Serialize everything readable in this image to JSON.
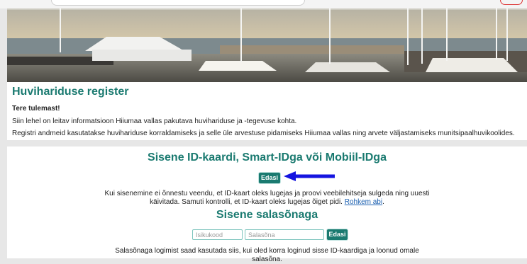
{
  "header": {
    "title": "Huvihariduse register",
    "welcome": "Tere tulemast!",
    "paragraph_1": "Siin lehel on leitav informatsioon Hiiumaa vallas pakutava huvihariduse ja -tegevuse kohta.",
    "paragraph_2": "Registri andmeid kasutatakse huvihariduse korraldamiseks ja selle üle arvestuse pidamiseks Hiiumaa vallas ning arvete väljastamiseks munitsipaalhuvikoolides."
  },
  "idcard_login": {
    "title": "Sisene ID-kaardi, Smart-IDga või Mobiil-IDga",
    "button_label": "Edasi",
    "info_line_1": "Kui sisenemine ei õnnestu veendu, et ID-kaart oleks lugejas ja proovi veebilehitseja sulgeda ning uuesti",
    "info_line_2_prefix": "käivitada. Samuti kontrolli, et ID-kaart oleks lugejas õiget pidi.",
    "info_link": "Rohkem abi",
    "info_line_2_suffix": "."
  },
  "password_login": {
    "title": "Sisene salasõnaga",
    "username_placeholder": "Isikukood",
    "password_placeholder": "Salasõna",
    "button_label": "Edasi",
    "info_line_1": "Salasõnaga logimist saad kasutada siis, kui oled korra loginud sisse ID-kaardiga ja loonud omale",
    "info_line_2": "salasõna."
  },
  "colors": {
    "accent": "#1a7a70",
    "link": "#1a5fb0",
    "annotation_arrow": "#1414e0"
  }
}
